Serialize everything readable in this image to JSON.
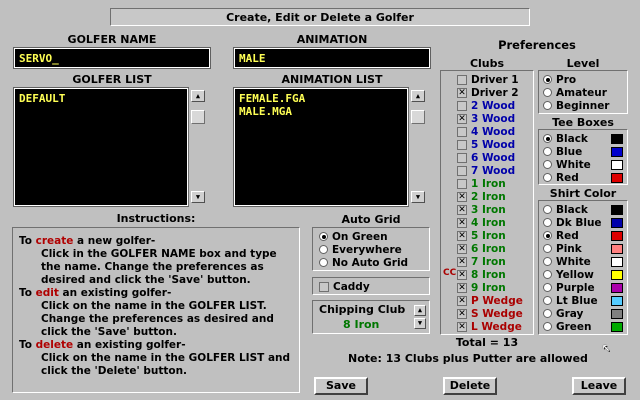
{
  "title": "Create, Edit or Delete a Golfer",
  "golfer_name": {
    "label": "GOLFER NAME",
    "value": "SERVO_"
  },
  "animation": {
    "label": "ANIMATION",
    "value": "MALE"
  },
  "golfer_list": {
    "label": "GOLFER LIST",
    "items": [
      "DEFAULT"
    ]
  },
  "animation_list": {
    "label": "ANIMATION LIST",
    "items": [
      "FEMALE.FGA",
      "MALE.MGA"
    ]
  },
  "instructions": {
    "label": "Instructions:",
    "create": {
      "pre": "To ",
      "kw": "create",
      "post": " a new golfer-",
      "body": "Click in the GOLFER NAME box and type the name.  Change the preferences as desired and click the 'Save' button."
    },
    "edit": {
      "pre": "To ",
      "kw": "edit",
      "post": " an existing golfer-",
      "body": "Click on the name in the GOLFER LIST. Change the preferences as desired and click the 'Save' button."
    },
    "delete": {
      "pre": "To ",
      "kw": "delete",
      "post": " an existing golfer-",
      "body": "Click on the name in the GOLFER LIST and click the 'Delete' button."
    }
  },
  "auto_grid": {
    "label": "Auto Grid",
    "options": [
      "On Green",
      "Everywhere",
      "No Auto Grid"
    ],
    "selected": 0
  },
  "caddy": {
    "label": "Caddy",
    "checked": false
  },
  "chipping_club": {
    "label": "Chipping Club",
    "value": "8 Iron"
  },
  "preferences": {
    "label": "Preferences",
    "clubs_label": "Clubs",
    "clubs": [
      {
        "name": "Driver 1",
        "checked": false,
        "color": "#000000",
        "mark": ""
      },
      {
        "name": "Driver 2",
        "checked": true,
        "color": "#000000",
        "mark": ""
      },
      {
        "name": "2 Wood",
        "checked": false,
        "color": "#0000aa",
        "mark": ""
      },
      {
        "name": "3 Wood",
        "checked": true,
        "color": "#0000aa",
        "mark": ""
      },
      {
        "name": "4 Wood",
        "checked": false,
        "color": "#0000aa",
        "mark": ""
      },
      {
        "name": "5 Wood",
        "checked": false,
        "color": "#0000aa",
        "mark": ""
      },
      {
        "name": "6 Wood",
        "checked": false,
        "color": "#0000aa",
        "mark": ""
      },
      {
        "name": "7 Wood",
        "checked": false,
        "color": "#0000aa",
        "mark": ""
      },
      {
        "name": "1 Iron",
        "checked": false,
        "color": "#007700",
        "mark": ""
      },
      {
        "name": "2 Iron",
        "checked": true,
        "color": "#007700",
        "mark": ""
      },
      {
        "name": "3 Iron",
        "checked": true,
        "color": "#007700",
        "mark": ""
      },
      {
        "name": "4 Iron",
        "checked": true,
        "color": "#007700",
        "mark": ""
      },
      {
        "name": "5 Iron",
        "checked": true,
        "color": "#007700",
        "mark": ""
      },
      {
        "name": "6 Iron",
        "checked": true,
        "color": "#007700",
        "mark": ""
      },
      {
        "name": "7 Iron",
        "checked": true,
        "color": "#007700",
        "mark": ""
      },
      {
        "name": "8 Iron",
        "checked": true,
        "color": "#007700",
        "mark": "CC"
      },
      {
        "name": "9 Iron",
        "checked": true,
        "color": "#007700",
        "mark": ""
      },
      {
        "name": "P Wedge",
        "checked": true,
        "color": "#aa0000",
        "mark": ""
      },
      {
        "name": "S Wedge",
        "checked": true,
        "color": "#aa0000",
        "mark": ""
      },
      {
        "name": "L Wedge",
        "checked": true,
        "color": "#aa0000",
        "mark": ""
      }
    ],
    "total": "Total = 13",
    "level": {
      "label": "Level",
      "options": [
        "Pro",
        "Amateur",
        "Beginner"
      ],
      "selected": 0
    },
    "tee_boxes": {
      "label": "Tee Boxes",
      "options": [
        {
          "name": "Black",
          "color": "#000000"
        },
        {
          "name": "Blue",
          "color": "#0000cc"
        },
        {
          "name": "White",
          "color": "#ffffff"
        },
        {
          "name": "Red",
          "color": "#dd0000"
        }
      ],
      "selected": 0
    },
    "shirt_color": {
      "label": "Shirt Color",
      "options": [
        {
          "name": "Black",
          "color": "#000000"
        },
        {
          "name": "Dk Blue",
          "color": "#0000aa"
        },
        {
          "name": "Red",
          "color": "#dd0000"
        },
        {
          "name": "Pink",
          "color": "#ff8080"
        },
        {
          "name": "White",
          "color": "#ffffff"
        },
        {
          "name": "Yellow",
          "color": "#ffff00"
        },
        {
          "name": "Purple",
          "color": "#aa00aa"
        },
        {
          "name": "Lt Blue",
          "color": "#55ccff"
        },
        {
          "name": "Gray",
          "color": "#808080"
        },
        {
          "name": "Green",
          "color": "#00aa00"
        }
      ],
      "selected": 2
    }
  },
  "note": "Note: 13 Clubs plus Putter are allowed",
  "buttons": {
    "save": "Save",
    "delete": "Delete",
    "leave": "Leave"
  }
}
